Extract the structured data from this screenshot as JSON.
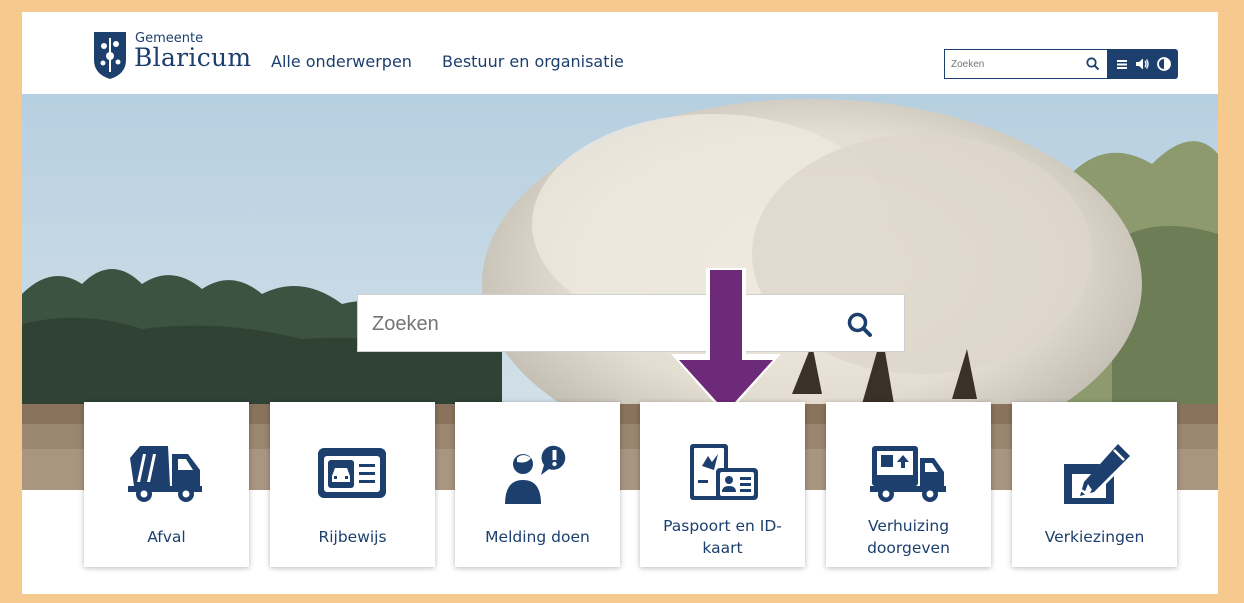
{
  "header": {
    "logo_small": "Gemeente",
    "logo_big": "Blaricum",
    "nav": [
      "Alle onderwerpen",
      "Bestuur en organisatie"
    ],
    "search_placeholder": "Zoeken",
    "tool_icons": [
      "menu-icon",
      "speaker-icon",
      "contrast-icon"
    ]
  },
  "hero": {
    "search_placeholder": "Zoeken",
    "arrow_color": "#6d2a79"
  },
  "tiles": [
    {
      "label": "Afval",
      "icon": "garbage-truck-icon"
    },
    {
      "label": "Rijbewijs",
      "icon": "driving-license-icon"
    },
    {
      "label": "Melding doen",
      "icon": "person-alert-icon"
    },
    {
      "label": "Paspoort en ID-kaart",
      "icon": "passport-id-icon"
    },
    {
      "label": "Verhuizing doorgeven",
      "icon": "moving-truck-icon"
    },
    {
      "label": "Verkiezingen",
      "icon": "ballot-pencil-icon"
    }
  ],
  "colors": {
    "brand": "#1c3f6e",
    "frame": "#f6c98f"
  }
}
